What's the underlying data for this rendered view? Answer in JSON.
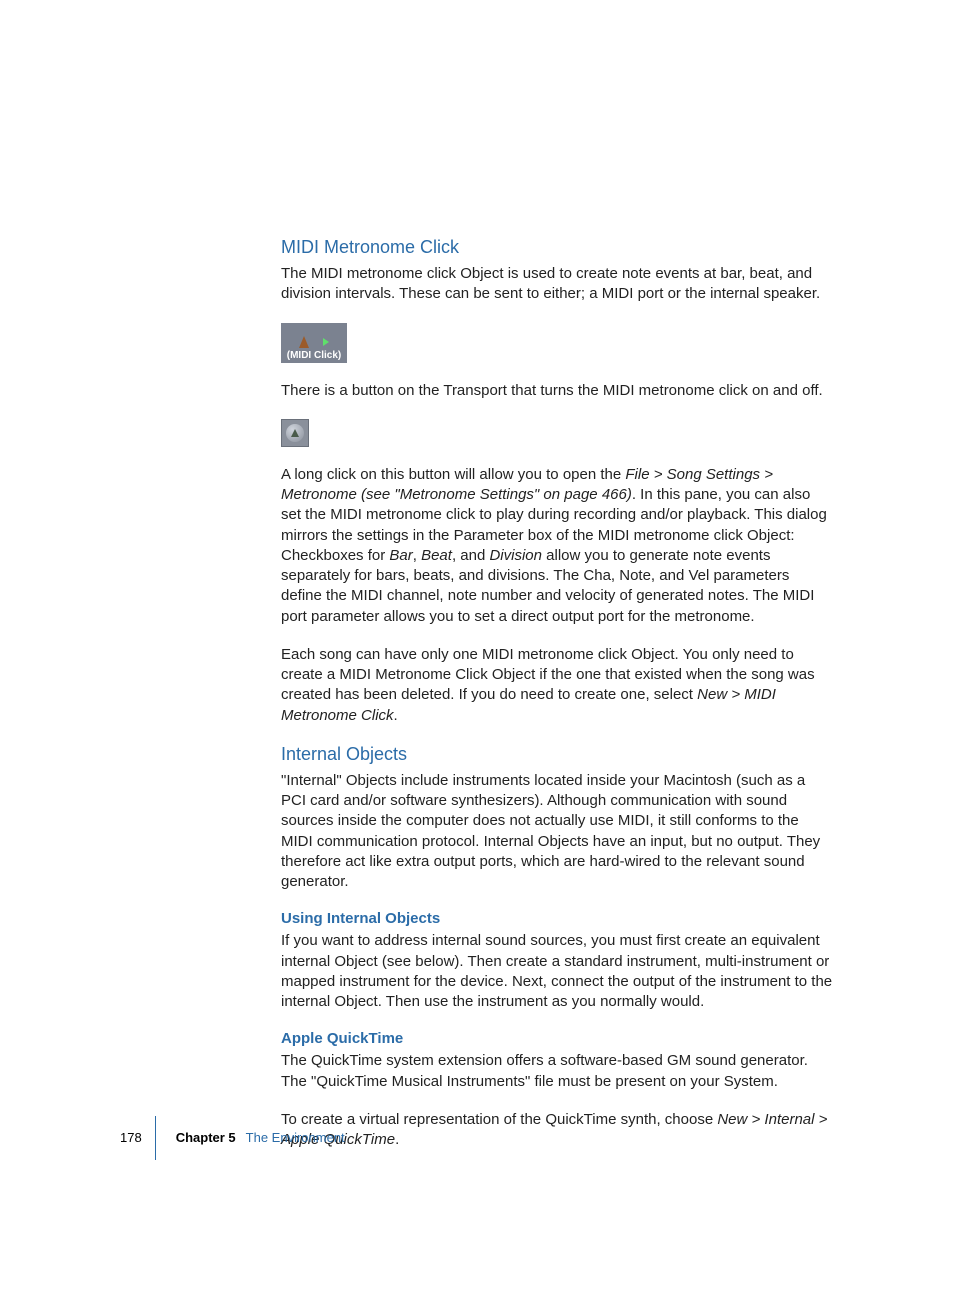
{
  "section1": {
    "heading": "MIDI Metronome Click",
    "p1": "The MIDI metronome click Object is used to create note events at bar, beat, and division intervals. These can be sent to either; a MIDI port or the internal speaker.",
    "img1_label": "(MIDI Click)",
    "p2": "There is a button on the Transport that turns the MIDI metronome click on and off.",
    "p3a": "A long click on this button will allow you to open the ",
    "p3b": "File > Song Settings > Metronome (see \"Metronome Settings\" on page 466)",
    "p3c": ". In this pane, you can also set the MIDI metronome click to play during recording and/or playback. This dialog mirrors the settings in the Parameter box of the MIDI metronome click Object:  Checkboxes for ",
    "p3d": "Bar",
    "p3e": ", ",
    "p3f": "Beat",
    "p3g": ", and ",
    "p3h": "Division",
    "p3i": " allow you to generate note events separately for bars, beats, and divisions. The Cha, Note, and Vel parameters define the MIDI channel, note number and velocity of generated notes. The MIDI port parameter allows you to set a direct output port for the metronome.",
    "p4a": "Each song can have only one MIDI metronome click Object. You only need to create a MIDI Metronome Click Object if the one that existed when the song was created has been deleted. If you do need to create one, select ",
    "p4b": "New > MIDI Metronome Click",
    "p4c": "."
  },
  "section2": {
    "heading": "Internal Objects",
    "p1": "\"Internal\" Objects include instruments located inside your Macintosh (such as a PCI card and/or software synthesizers). Although communication with sound sources inside the computer does not actually use MIDI, it still conforms to the MIDI communication protocol. Internal Objects have an input, but no output. They therefore act like extra output ports, which are hard-wired to the relevant sound generator.",
    "sub1": {
      "heading": "Using Internal Objects",
      "p1": "If you want to address internal sound sources, you must first create an equivalent internal Object (see below). Then create a standard instrument, multi-instrument or mapped instrument for the device. Next, connect the output of the instrument to the internal Object. Then use the instrument as you normally would."
    },
    "sub2": {
      "heading": "Apple QuickTime",
      "p1": "The QuickTime system extension offers a software-based GM sound generator. The \"QuickTime Musical Instruments\" file must be present on your System.",
      "p2a": "To create a virtual representation of the QuickTime synth, choose ",
      "p2b": "New > Internal > Apple QuickTime",
      "p2c": "."
    }
  },
  "footer": {
    "page": "178",
    "chapter": "Chapter 5",
    "title": "The Environment"
  }
}
